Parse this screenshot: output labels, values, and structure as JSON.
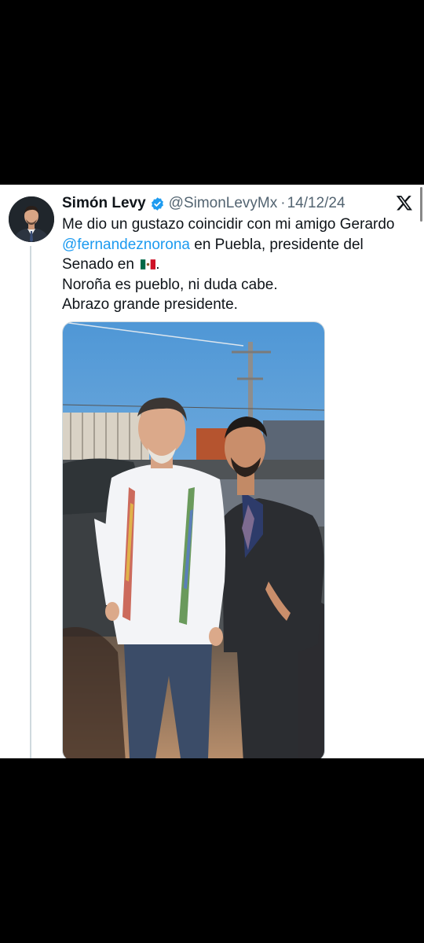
{
  "tweet": {
    "author": {
      "display_name": "Simón Levy",
      "handle": "@SimonLevyMx",
      "verified": true
    },
    "separator": "·",
    "date": "14/12/24",
    "text": {
      "line1": "Me dio un gustazo coincidir con mi amigo Gerardo",
      "mention": "@fernandeznorona",
      "after_mention": " en Puebla, presidente del Senado en ",
      "after_flag": ".",
      "line3": "Noroña es pueblo, ni duda cabe.",
      "line4": "Abrazo grande presidente."
    },
    "flag_icon": "mexico-flag-emoji",
    "colors": {
      "mention": "#1d9bf0",
      "verified": "#1d9bf0",
      "meta_text": "#536471"
    }
  },
  "icons": {
    "platform": "x-logo-icon",
    "verified": "verified-badge-icon"
  }
}
